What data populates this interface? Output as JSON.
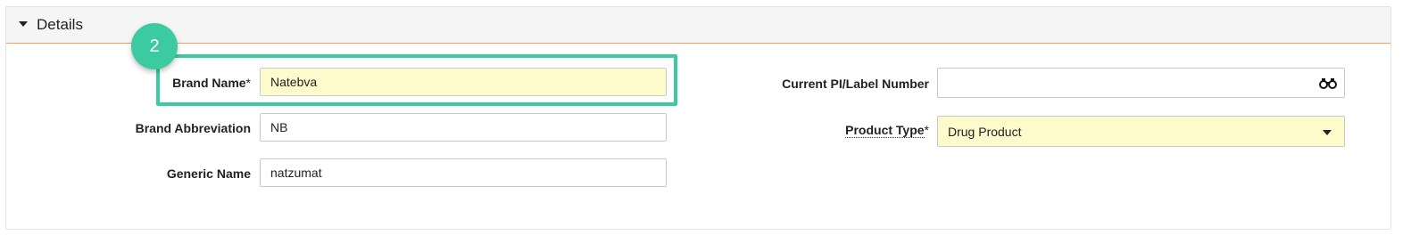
{
  "panel": {
    "title": "Details"
  },
  "step_badge": "2",
  "fields": {
    "brand_name": {
      "label": "Brand Name",
      "required_mark": "*",
      "value": "Natebva"
    },
    "brand_abbreviation": {
      "label": "Brand Abbreviation",
      "value": "NB"
    },
    "generic_name": {
      "label": "Generic Name",
      "value": "natzumat"
    },
    "current_pi_label_number": {
      "label": "Current PI/Label Number",
      "value": ""
    },
    "product_type": {
      "label": "Product Type",
      "required_mark": "*",
      "value": "Drug Product"
    }
  },
  "colors": {
    "highlight": "#3ccaa0",
    "required_field_bg": "#fdfbcc",
    "header_border": "#f0a060"
  },
  "icons": {
    "collapse": "caret-down-icon",
    "lookup": "binoculars-icon",
    "dropdown": "dropdown-caret-icon"
  }
}
